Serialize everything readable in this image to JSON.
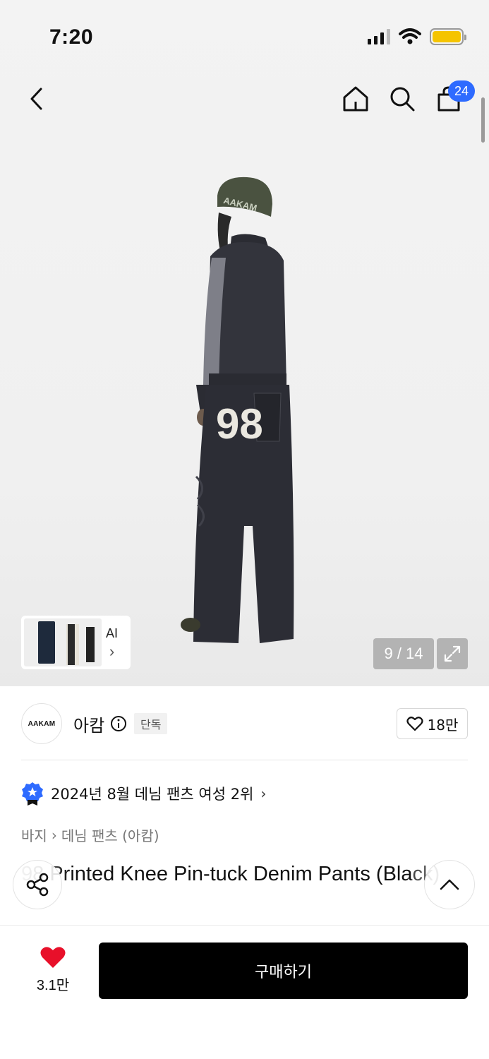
{
  "status_bar": {
    "time": "7:20"
  },
  "nav": {
    "cart_count": "24"
  },
  "gallery": {
    "counter": "9 / 14",
    "thumb_ai_label": "AI",
    "thumb_ai_chevron": "›",
    "model_cap_text": "AAKAM",
    "model_number": "98"
  },
  "brand": {
    "logo_text": "AAKAM",
    "name": "아캄",
    "badge": "단독",
    "like_count": "18만"
  },
  "ranking": {
    "text": "2024년 8월 데님 팬츠 여성 2위",
    "chevron": "›"
  },
  "breadcrumb": {
    "level1": "바지",
    "separator": "›",
    "level2": "데님 팬츠 (아캄)"
  },
  "product": {
    "title": "98 Printed Knee Pin-tuck Denim Pants (Black)"
  },
  "bottom_bar": {
    "wish_count": "3.1만",
    "buy_label": "구매하기"
  },
  "colors": {
    "accent_blue": "#2e6bff",
    "battery_yellow": "#f5c400",
    "heart_red": "#e8102a",
    "buy_button_bg": "#000000"
  },
  "icons": [
    "back-icon",
    "home-icon",
    "search-icon",
    "cart-icon",
    "expand-icon",
    "info-icon",
    "heart-outline-icon",
    "ranking-badge-icon",
    "share-icon",
    "chevron-up-icon",
    "heart-filled-icon",
    "wifi-icon",
    "signal-icon",
    "battery-icon"
  ]
}
